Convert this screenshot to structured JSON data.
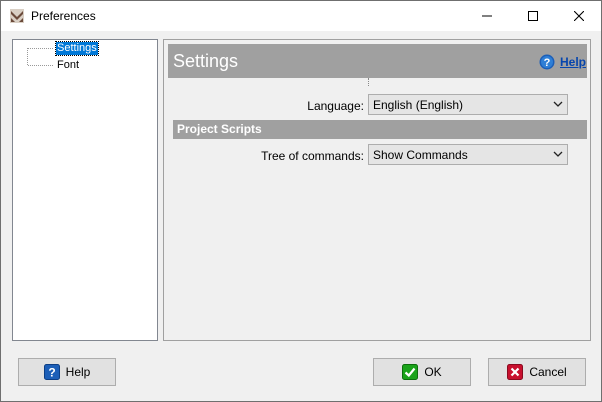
{
  "window": {
    "title": "Preferences",
    "app_icon": "preferences-app-icon",
    "controls": [
      "minimize-icon",
      "maximize-icon",
      "close-icon"
    ]
  },
  "tree": {
    "items": [
      {
        "label": "Settings",
        "selected": true
      },
      {
        "label": "Font",
        "selected": false
      }
    ]
  },
  "settings": {
    "title": "Settings",
    "help_label": "Help",
    "language_label": "Language:",
    "language_value": "English (English)",
    "section_title": "Project Scripts",
    "tree_commands_label": "Tree of commands:",
    "tree_commands_value": "Show Commands"
  },
  "buttons": {
    "help": "Help",
    "ok": "OK",
    "cancel": "Cancel"
  },
  "colors": {
    "header_bg": "#a0a0a0",
    "selection": "#0078d7",
    "link": "#0645ad",
    "ok_green": "#1aa31a",
    "cancel_red": "#c8102e",
    "help_blue": "#1c5fb8"
  }
}
